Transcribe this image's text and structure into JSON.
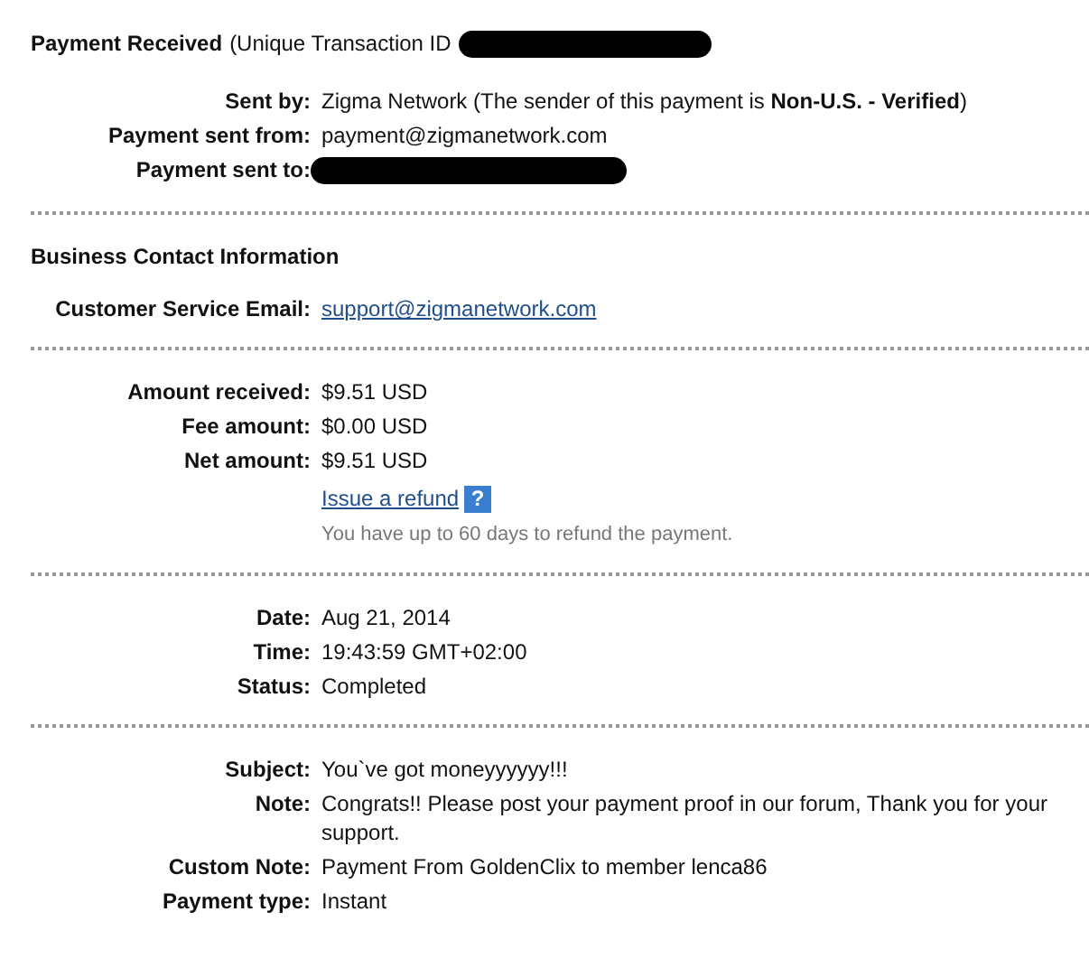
{
  "header": {
    "title": "Payment Received",
    "subtitle": "(Unique Transaction ID",
    "redacted": true
  },
  "sections": [
    {
      "rows": [
        {
          "kind": "rich",
          "label": "Sent by:",
          "value": "Zigma Network (The sender of this payment is **Non-U.S. - Verified**)"
        },
        {
          "kind": "text",
          "label": "Payment sent from:",
          "value": "payment@zigmanetwork.com"
        },
        {
          "kind": "redacted",
          "label": "Payment sent to:"
        }
      ]
    },
    {
      "heading": "Business Contact Information",
      "rows": [
        {
          "kind": "link",
          "label": "Customer Service Email:",
          "value": "support@zigmanetwork.com"
        }
      ]
    },
    {
      "rows": [
        {
          "kind": "text",
          "label": "Amount received:",
          "value": "$9.51 USD"
        },
        {
          "kind": "text",
          "label": "Fee amount:",
          "value": "$0.00 USD"
        },
        {
          "kind": "text",
          "label": "Net amount:",
          "value": "$9.51 USD"
        },
        {
          "kind": "refund",
          "link": "Issue a refund",
          "help": "?",
          "note": "You have up to 60 days to refund the payment."
        }
      ]
    },
    {
      "rows": [
        {
          "kind": "text",
          "label": "Date:",
          "value": "Aug 21, 2014"
        },
        {
          "kind": "text",
          "label": "Time:",
          "value": "19:43:59 GMT+02:00"
        },
        {
          "kind": "text",
          "label": "Status:",
          "value": "Completed"
        }
      ]
    },
    {
      "rows": [
        {
          "kind": "text",
          "label": "Subject:",
          "value": "You`ve got moneyyyyyy!!!"
        },
        {
          "kind": "text",
          "label": "Note:",
          "value": "Congrats!! Please post your payment proof in our forum, Thank you for your support."
        },
        {
          "kind": "text",
          "label": "Custom Note:",
          "value": "Payment From GoldenClix to member lenca86"
        },
        {
          "kind": "text",
          "label": "Payment type:",
          "value": "Instant"
        }
      ]
    }
  ]
}
